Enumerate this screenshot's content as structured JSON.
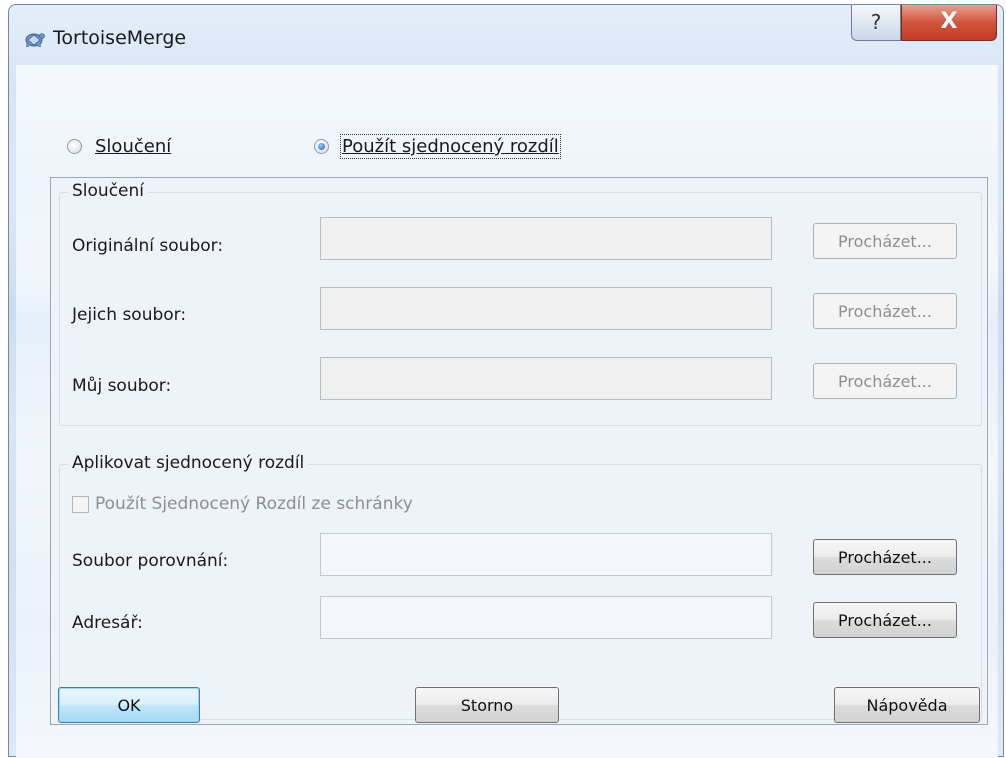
{
  "window": {
    "title": "TortoiseMerge",
    "help_glyph": "?",
    "close_glyph": "X",
    "icons": {
      "app": "tortoise-icon",
      "help": "help-icon",
      "close": "close-icon"
    }
  },
  "mode": {
    "merge_label": "Sloučení",
    "merge_selected": false,
    "patch_label": "Použít sjednocený rozdíl",
    "patch_selected": true
  },
  "merge_group": {
    "title": "Sloučení",
    "rows": [
      {
        "label": "Originální soubor:",
        "value": "",
        "browse": "Procházet..."
      },
      {
        "label": "Jejich soubor:",
        "value": "",
        "browse": "Procházet..."
      },
      {
        "label": "Můj soubor:",
        "value": "",
        "browse": "Procházet..."
      }
    ]
  },
  "patch_group": {
    "title": "Aplikovat sjednocený rozdíl",
    "clipboard_label": "Použít Sjednocený Rozdíl ze schránky",
    "clipboard_checked": false,
    "rows": [
      {
        "label": "Soubor porovnání:",
        "value": "",
        "browse": "Procházet..."
      },
      {
        "label": "Adresář:",
        "value": "",
        "browse": "Procházet..."
      }
    ]
  },
  "buttons": {
    "ok": "OK",
    "cancel": "Storno",
    "help": "Nápověda"
  },
  "colors": {
    "close_red": "#c33a23",
    "radio_blue": "#1d5fa8",
    "disabled_text": "#8b8f93"
  }
}
